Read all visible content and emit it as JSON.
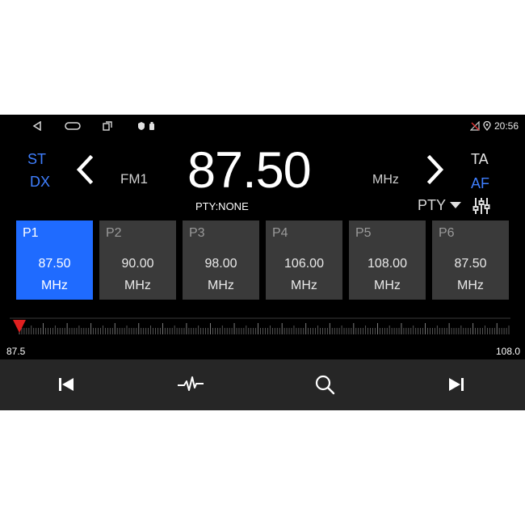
{
  "status_bar": {
    "time": "20:56"
  },
  "radio": {
    "st": "ST",
    "dx": "DX",
    "band": "FM1",
    "frequency": "87.50",
    "unit": "MHz",
    "ta": "TA",
    "af": "AF",
    "pty_text": "PTY:NONE",
    "pty_button": "PTY"
  },
  "presets": [
    {
      "name": "P1",
      "freq": "87.50",
      "unit": "MHz",
      "active": true
    },
    {
      "name": "P2",
      "freq": "90.00",
      "unit": "MHz",
      "active": false
    },
    {
      "name": "P3",
      "freq": "98.00",
      "unit": "MHz",
      "active": false
    },
    {
      "name": "P4",
      "freq": "106.00",
      "unit": "MHz",
      "active": false
    },
    {
      "name": "P5",
      "freq": "108.00",
      "unit": "MHz",
      "active": false
    },
    {
      "name": "P6",
      "freq": "87.50",
      "unit": "MHz",
      "active": false
    }
  ],
  "scale": {
    "min_label": "87.5",
    "max_label": "108.0",
    "current": 87.5
  },
  "colors": {
    "accent": "#1f6bff",
    "label_blue": "#3f7fff",
    "marker": "#e02020"
  },
  "icons": {
    "back": "back-triangle-icon",
    "home": "home-pill-icon",
    "recents": "recents-icon",
    "prev": "chevron-left-icon",
    "next": "chevron-right-icon",
    "eq": "equalizer-icon",
    "seek_prev": "skip-previous-icon",
    "wave": "waveform-icon",
    "search": "search-icon",
    "seek_next": "skip-next-icon"
  }
}
